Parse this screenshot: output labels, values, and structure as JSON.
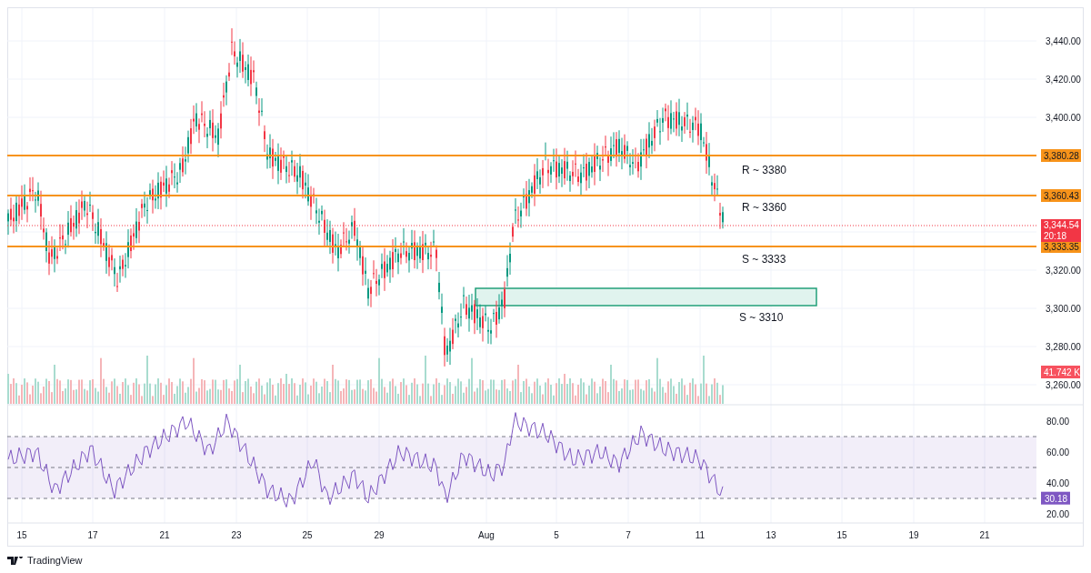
{
  "price_pane": {
    "y_axis_labels": [
      "3,440.00",
      "3,420.00",
      "3,400.00",
      "3,320.00",
      "3,300.00",
      "3,280.00",
      "3,260.00"
    ],
    "levels": [
      {
        "label": "R ~ 3380",
        "tag": "3,380.28"
      },
      {
        "label": "R ~ 3360",
        "tag": "3,360.43"
      },
      {
        "label": "S ~ 3333",
        "tag": "3,333.35"
      }
    ],
    "zone": {
      "label": "S ~ 3310"
    },
    "last_price": {
      "tag": "3,344.54",
      "countdown": "20:18"
    },
    "volume_tag": "41.742 K"
  },
  "rsi_pane": {
    "y_axis_labels": [
      "80.00",
      "60.00",
      "40.00",
      "20.00"
    ],
    "value_tag": "30.18"
  },
  "x_axis_labels": [
    "15",
    "17",
    "21",
    "23",
    "25",
    "29",
    "Aug",
    "5",
    "7",
    "11",
    "13",
    "15",
    "19",
    "21"
  ],
  "footer": {
    "brand": "TradingView"
  }
}
